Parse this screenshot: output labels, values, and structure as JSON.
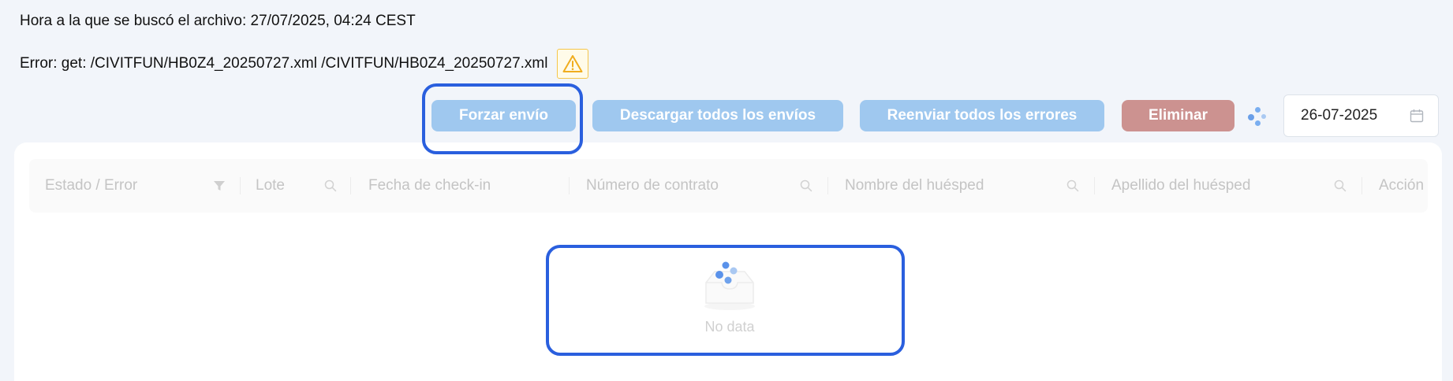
{
  "header": {
    "search_time": "Hora a la que se buscó el archivo: 27/07/2025, 04:24 CEST",
    "error_message": "Error: get: /CIVITFUN/HB0Z4_20250727.xml /CIVITFUN/HB0Z4_20250727.xml"
  },
  "toolbar": {
    "force_send": "Forzar envío",
    "download_all": "Descargar todos los envíos",
    "resend_errors": "Reenviar todos los errores",
    "delete": "Eliminar",
    "date_value": "26-07-2025"
  },
  "table": {
    "columns": [
      {
        "label": "Estado / Error",
        "icon": "filter-icon"
      },
      {
        "label": "Lote",
        "icon": "search-icon"
      },
      {
        "label": "Fecha de check-in",
        "icon": ""
      },
      {
        "label": "Número de contrato",
        "icon": "search-icon"
      },
      {
        "label": "Nombre del huésped",
        "icon": "search-icon"
      },
      {
        "label": "Apellido del huésped",
        "icon": "search-icon"
      },
      {
        "label": "Acción",
        "icon": ""
      }
    ],
    "empty_text": "No data"
  },
  "colors": {
    "primary_button": "#9fc8ef",
    "danger_button": "#cc9290",
    "highlight": "#2a5fde",
    "warning": "#f5c64a"
  }
}
